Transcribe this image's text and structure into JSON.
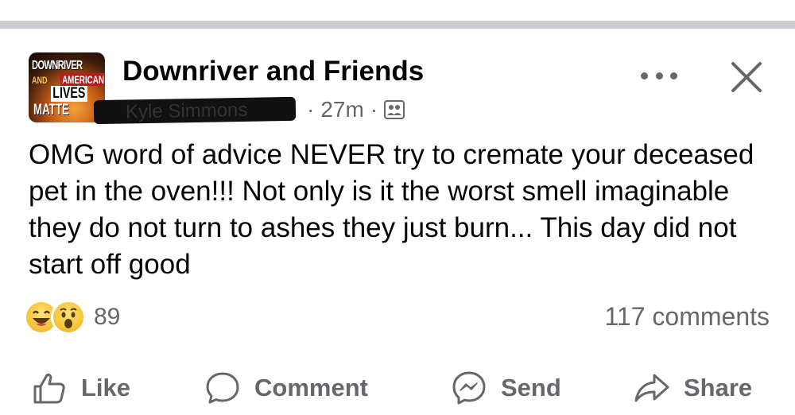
{
  "post": {
    "group_name": "Downriver and Friends",
    "author_name_redacted": "Kyle Simmons",
    "time": "27m",
    "separator": "·",
    "body": "OMG word of advice NEVER try to cremate your deceased pet in the oven!!! Not only is it the worst smell imaginable they do not turn to ashes they just burn... This day did not start off good"
  },
  "group_avatar": {
    "line1": "DOWNRIVER",
    "line2": "AND",
    "line3": "AMERICAN",
    "line4": "LIVES",
    "line5": "MATTE"
  },
  "reactions": {
    "icons": [
      "laugh-emoji-icon",
      "wow-emoji-icon"
    ],
    "count": "89"
  },
  "comments": {
    "label": "117 comments"
  },
  "actions": {
    "like": "Like",
    "comment": "Comment",
    "send": "Send",
    "share": "Share"
  },
  "colors": {
    "secondary_text": "#65676b",
    "divider": "#c9ccd1",
    "emoji_yellow": "#f7c53a"
  }
}
